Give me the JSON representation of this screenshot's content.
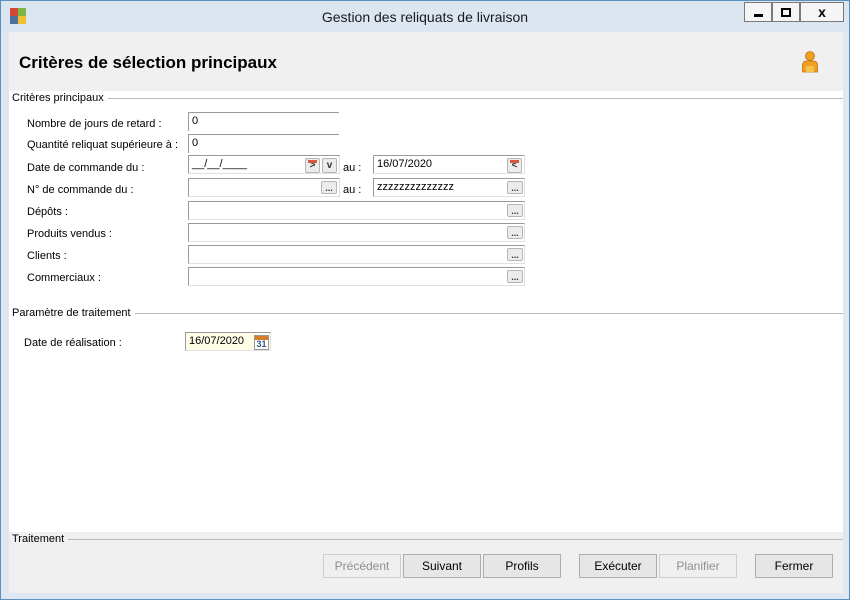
{
  "window": {
    "title": "Gestion des reliquats de livraison",
    "close_glyph": "x"
  },
  "header": {
    "title": "Critères de sélection principaux",
    "user_icon": "user-icon"
  },
  "group_main": {
    "label": "Critères principaux",
    "fields": [
      {
        "label": "Nombre de jours de retard :",
        "value": "0"
      },
      {
        "label": "Quantité reliquat supérieure à :",
        "value": "0"
      },
      {
        "label": "Date de commande du :",
        "value": "__/__/____",
        "to_label": "au :",
        "to_value": "16/07/2020"
      },
      {
        "label": "N° de commande du :",
        "value": "",
        "to_label": "au :",
        "to_value": "zzzzzzzzzzzzzz"
      },
      {
        "label": "Dépôts :",
        "value": ""
      },
      {
        "label": "Produits vendus :",
        "value": ""
      },
      {
        "label": "Clients :",
        "value": ""
      },
      {
        "label": "Commerciaux :",
        "value": ""
      }
    ]
  },
  "group_params": {
    "label": "Paramètre de traitement",
    "date_label": "Date de réalisation :",
    "date_value": "16/07/2020",
    "calendar_day": "31"
  },
  "group_processing": {
    "label": "Traitement"
  },
  "buttons": {
    "previous": "Précédent",
    "next": "Suivant",
    "profiles": "Profils",
    "execute": "Exécuter",
    "schedule": "Planifier",
    "close": "Fermer"
  },
  "icons": {
    "dots": "...",
    "next_glyph": ">",
    "down_glyph": "v",
    "back_glyph": "<"
  }
}
